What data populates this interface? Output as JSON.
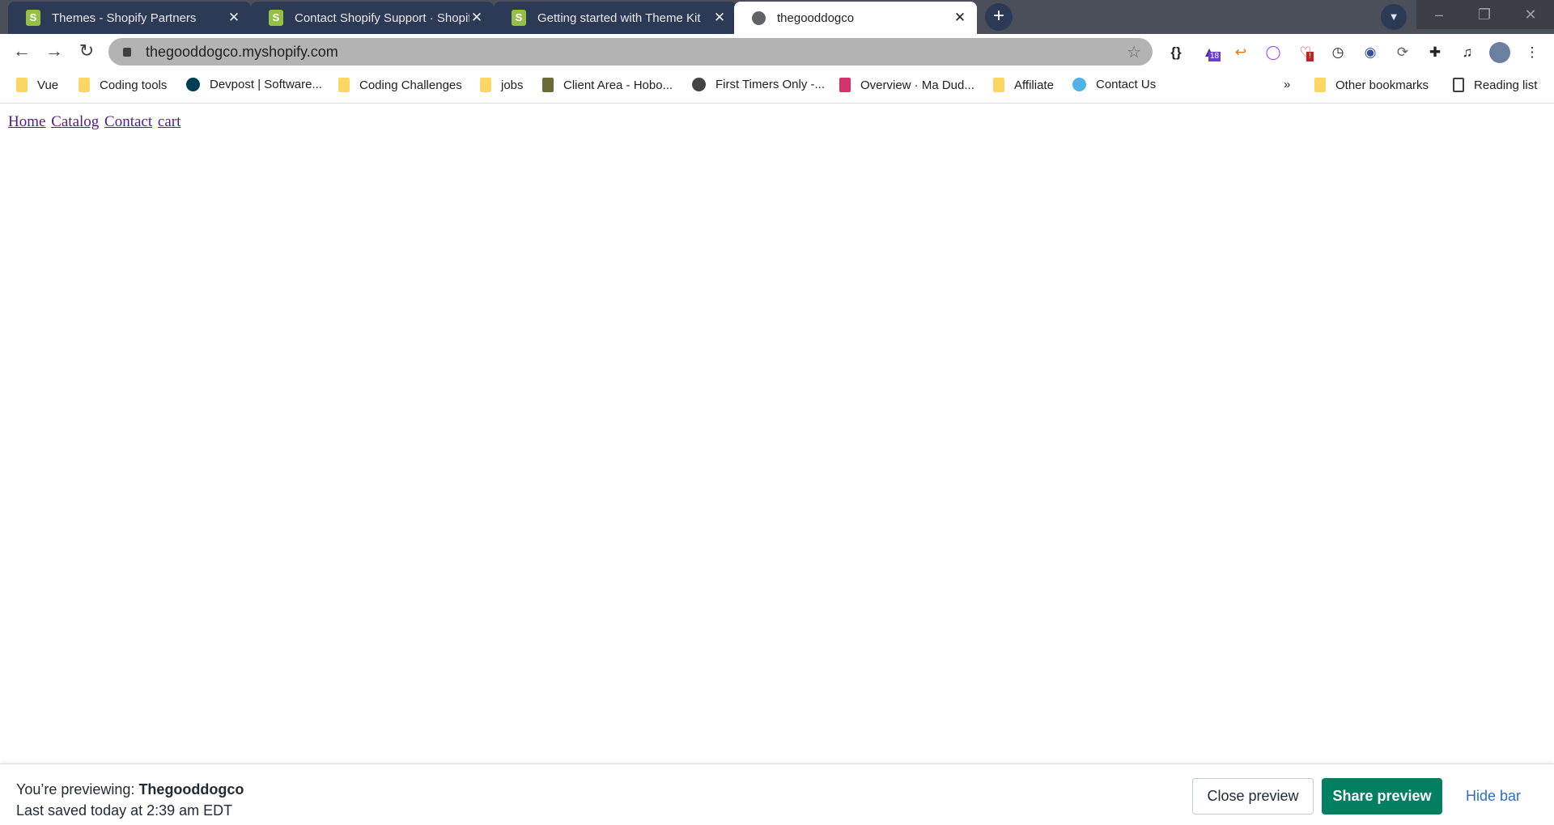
{
  "tabs": [
    {
      "title": "Themes - Shopify Partners",
      "icon": "shopify-icon"
    },
    {
      "title": "Contact Shopify Support · Shopify",
      "icon": "shopify-icon"
    },
    {
      "title": "Getting started with Theme Kit",
      "icon": "shopify-icon"
    },
    {
      "title": "thegooddogco",
      "icon": "globe-icon",
      "active": true
    }
  ],
  "address": "thegooddogco.myshopify.com",
  "extensions": [
    "{}",
    "18",
    "!"
  ],
  "bookmarks": [
    "Vue",
    "Coding tools",
    "Devpost | Software...",
    "Coding Challenges",
    "jobs",
    "Client Area - Hobo...",
    "First Timers Only -...",
    "Overview · Ma Dud...",
    "Affiliate",
    "Contact Us"
  ],
  "bookmarks_right": {
    "more": "»",
    "other": "Other bookmarks",
    "reading": "Reading list"
  },
  "page": {
    "links": [
      "Home",
      "Catalog",
      "Contact",
      "cart"
    ]
  },
  "preview_bar": {
    "previewing_label": "You’re previewing: ",
    "theme_name": "Thegooddogco",
    "last_saved": "Last saved today at 2:39 am EDT",
    "close": "Close preview",
    "share": "Share preview",
    "hide": "Hide bar",
    "accent": "#008060"
  }
}
